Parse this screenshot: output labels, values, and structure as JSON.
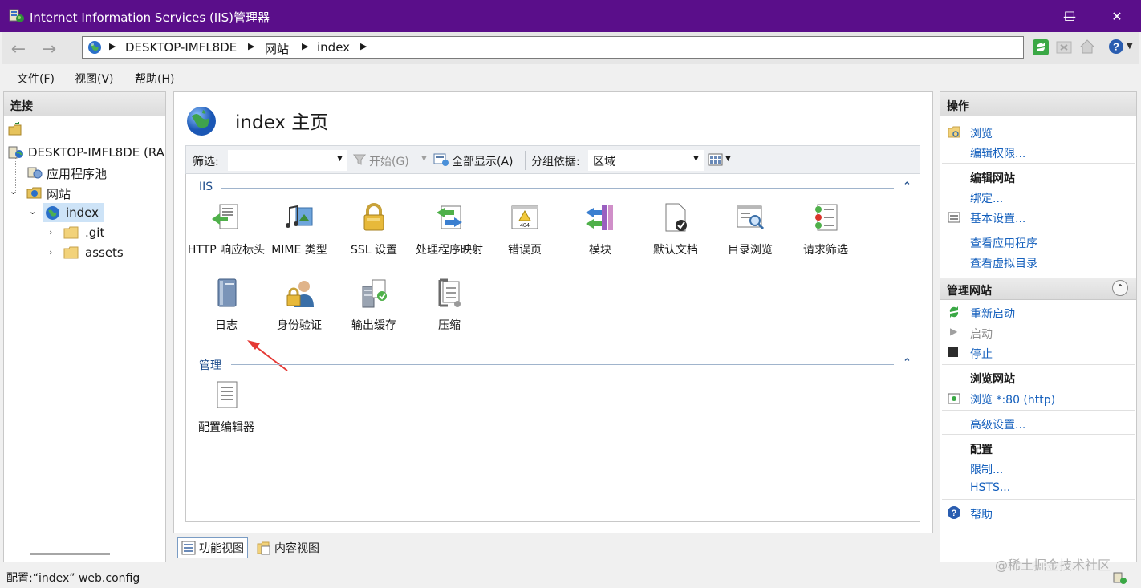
{
  "window": {
    "title": "Internet Information Services (IIS)管理器",
    "minimize": "—",
    "maximize": "☐",
    "close": "✕"
  },
  "address": {
    "crumbs": [
      "DESKTOP-IMFL8DE",
      "网站",
      "index"
    ],
    "sep": "▶"
  },
  "menu": [
    "文件(F)",
    "视图(V)",
    "帮助(H)"
  ],
  "connections": {
    "title": "连接",
    "tree": {
      "server": "DESKTOP-IMFL8DE (RA",
      "app_pools": "应用程序池",
      "sites": "网站",
      "site": "index",
      "folders": [
        ".git",
        "assets"
      ]
    }
  },
  "main": {
    "page_title": "index 主页",
    "filter": {
      "label": "筛选:",
      "value": "",
      "start": "开始(G)",
      "show_all": "全部显示(A)",
      "group_label": "分组依据:",
      "group_value": "区域"
    },
    "groups": [
      {
        "label": "IIS",
        "items": [
          "HTTP 响应标头",
          "MIME 类型",
          "SSL 设置",
          "处理程序映射",
          "错误页",
          "模块",
          "默认文档",
          "目录浏览",
          "请求筛选",
          "日志",
          "身份验证",
          "输出缓存",
          "压缩"
        ]
      },
      {
        "label": "管理",
        "items": [
          "配置编辑器"
        ]
      }
    ],
    "tabs": [
      "功能视图",
      "内容视图"
    ]
  },
  "actions": {
    "title": "操作",
    "browse": "浏览",
    "edit_permissions": "编辑权限...",
    "edit_site": {
      "title": "编辑网站",
      "items": [
        "绑定...",
        "基本设置...",
        "查看应用程序",
        "查看虚拟目录"
      ]
    },
    "manage_site": {
      "title": "管理网站",
      "restart": "重新启动",
      "start": "启动",
      "stop": "停止"
    },
    "browse_site": {
      "title": "浏览网站",
      "link": "浏览 *:80 (http)"
    },
    "advanced": "高级设置...",
    "config": {
      "title": "配置",
      "items": [
        "限制...",
        "HSTS..."
      ]
    },
    "help": "帮助"
  },
  "status": {
    "text": "配置:“index” web.config",
    "watermark": "@稀土掘金技术社区"
  },
  "colors": {
    "titlebar": "#5a0e8a",
    "link": "#1560bd",
    "annotation_arrow": "#e53935"
  }
}
